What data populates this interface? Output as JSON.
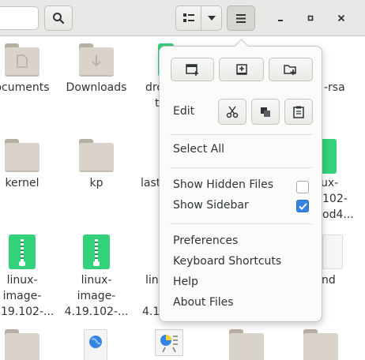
{
  "header": {
    "search_icon": "search-icon",
    "view_icon": "view-list-icon",
    "view_dropdown_icon": "chevron-down-icon",
    "menu_icon": "hamburger-menu-icon",
    "window_controls": [
      "minimize-icon",
      "maximize-icon",
      "close-icon"
    ]
  },
  "files": [
    {
      "label": "ocuments",
      "icon": "folder-documents-icon"
    },
    {
      "label": "Downloads",
      "icon": "folder-download-icon"
    },
    {
      "label_lines": [
        "dro",
        "t"
      ],
      "icon": "folder-icon"
    },
    {
      "label": "-rsa",
      "icon": "file-icon"
    },
    {
      "label": "kernel",
      "icon": "folder-icon"
    },
    {
      "label": "kp",
      "icon": "folder-icon"
    },
    {
      "label": "last",
      "icon": "folder-icon"
    },
    {
      "label_lines": [
        "ux-",
        "102-",
        "od4..."
      ],
      "icon": "archive-icon"
    },
    {
      "label_lines": [
        "linux-",
        "image-",
        "4.19.102-..."
      ],
      "icon": "archive-icon"
    },
    {
      "label_lines": [
        "linux-",
        "image-",
        "4.19.102-..."
      ],
      "icon": "archive-icon"
    },
    {
      "label_lines": [
        "lin",
        "4.1"
      ],
      "icon": "archive-icon"
    },
    {
      "label": "nd",
      "icon": "file-icon"
    }
  ],
  "menu": {
    "top_buttons": [
      "new-window-icon",
      "new-tab-icon",
      "new-folder-icon"
    ],
    "edit_label": "Edit",
    "edit_buttons": [
      "cut-icon",
      "copy-icon",
      "paste-icon"
    ],
    "select_all": "Select All",
    "show_hidden_files": "Show Hidden Files",
    "show_hidden_files_checked": false,
    "show_sidebar": "Show Sidebar",
    "show_sidebar_checked": true,
    "preferences": "Preferences",
    "keyboard_shortcuts": "Keyboard Shortcuts",
    "help": "Help",
    "about_files": "About Files"
  },
  "colors": {
    "accent": "#3584e4",
    "archive_green": "#33d17a",
    "folder": "#d9d3cb"
  }
}
